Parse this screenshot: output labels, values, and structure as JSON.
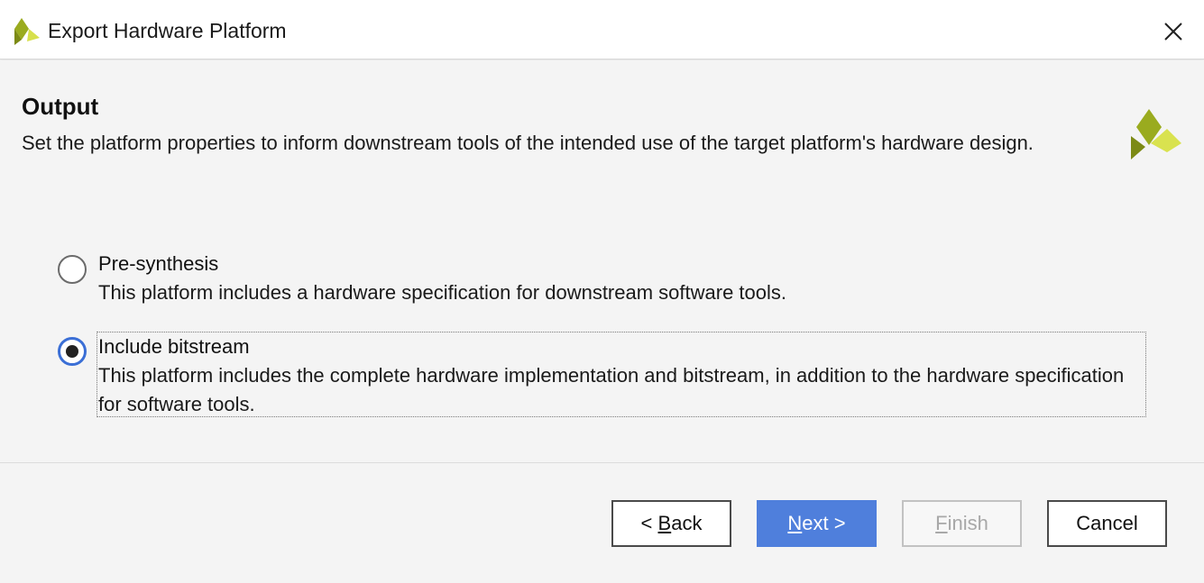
{
  "window": {
    "title": "Export Hardware Platform",
    "close_icon": "close-icon",
    "logo_icon": "xilinx-logo-icon"
  },
  "page": {
    "heading": "Output",
    "description": "Set the platform properties to inform downstream tools of the intended use of the target platform's hardware design."
  },
  "options": [
    {
      "label": "Pre-synthesis",
      "description": "This platform includes a hardware specification for downstream software tools.",
      "selected": false
    },
    {
      "label": "Include bitstream",
      "description": "This platform includes the complete hardware implementation and bitstream, in addition to the hardware specification for software tools.",
      "selected": true
    }
  ],
  "buttons": {
    "back": {
      "prefix": "< ",
      "mnemonic": "B",
      "rest": "ack"
    },
    "next": {
      "mnemonic": "N",
      "rest": "ext >"
    },
    "finish": {
      "mnemonic": "F",
      "rest": "inish"
    },
    "cancel": "Cancel"
  },
  "colors": {
    "accent": "#4f7fdc",
    "logo_dark": "#8a9a1b",
    "logo_light": "#d6e04a"
  }
}
